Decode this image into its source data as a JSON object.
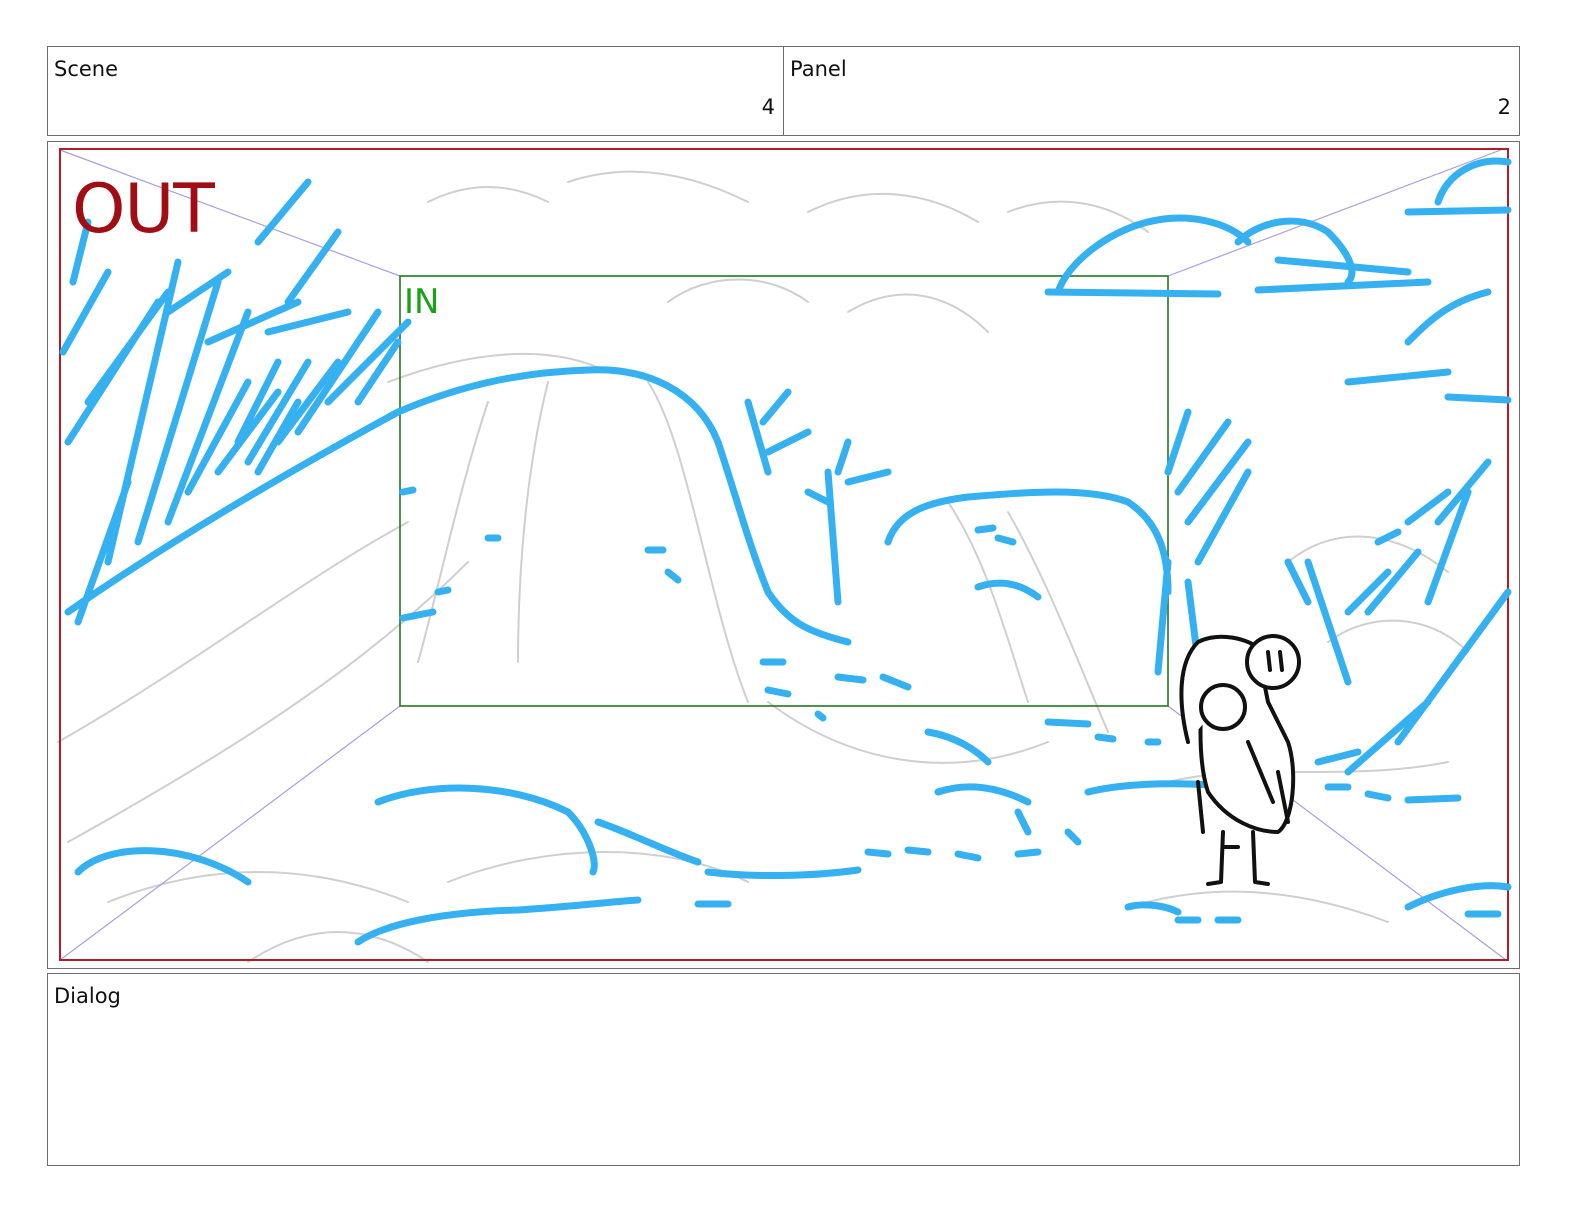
{
  "header": {
    "scene_label": "Scene",
    "scene_value": "4",
    "panel_label": "Panel",
    "panel_value": "2"
  },
  "frame": {
    "out_label": "OUT",
    "in_label": "IN",
    "colors": {
      "out_frame": "#b01c2a",
      "in_frame": "#1f7a1f",
      "in_text": "#1aa01a",
      "out_text": "#a00d14",
      "blue_strokes": "#35b0f0",
      "pencil": "#c8c8c8",
      "character": "#111111",
      "perspective": "#9a90d8"
    }
  },
  "dialog": {
    "label": "Dialog",
    "text": ""
  }
}
